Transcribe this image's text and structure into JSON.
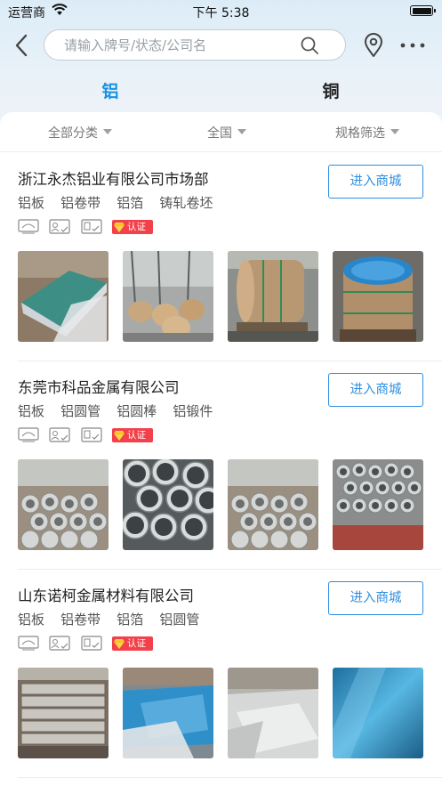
{
  "status_bar": {
    "carrier": "运营商",
    "time": "下午 5:38"
  },
  "header": {
    "search_placeholder": "请输入牌号/状态/公司名"
  },
  "tabs": [
    {
      "label": "铝",
      "active": true
    },
    {
      "label": "铜",
      "active": false
    }
  ],
  "filters": [
    {
      "label": "全部分类"
    },
    {
      "label": "全国"
    },
    {
      "label": "规格筛选"
    }
  ],
  "companies": [
    {
      "name": "浙江永杰铝业有限公司市场部",
      "button_label": "进入商城",
      "tags": [
        "铝板",
        "铝卷带",
        "铝箔",
        "铸轧卷坯"
      ],
      "cert_label": "认证",
      "photos": [
        "aluminum-sheet-photo",
        "aluminum-coils-warehouse-photo",
        "wrapped-coil-photo",
        "blue-coil-photo"
      ]
    },
    {
      "name": "东莞市科品金属有限公司",
      "button_label": "进入商城",
      "tags": [
        "铝板",
        "铝圆管",
        "铝圆棒",
        "铝锻件"
      ],
      "cert_label": "认证",
      "photos": [
        "tube-bundle-photo",
        "tube-ends-photo",
        "tube-bundle-photo",
        "tube-stack-photo"
      ]
    },
    {
      "name": "山东诺柯金属材料有限公司",
      "button_label": "进入商城",
      "tags": [
        "铝板",
        "铝卷带",
        "铝箔",
        "铝圆管"
      ],
      "cert_label": "认证",
      "photos": [
        "plate-stack-photo",
        "blue-film-sheet-photo",
        "silver-sheet-photo",
        "blue-sheet-photo"
      ]
    }
  ],
  "colors": {
    "accent": "#1592e6",
    "button_border": "#2f8ee0",
    "cert_badge": "#f2414b"
  }
}
